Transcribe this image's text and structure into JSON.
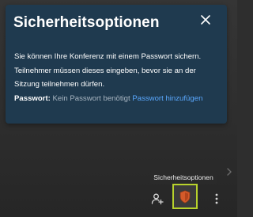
{
  "dialog": {
    "title": "Sicherheitsoptionen",
    "description": "Sie können Ihre Konferenz mit einem Passwort sichern. Teilnehmer müssen dieses eingeben, bevor sie an der Sitzung teilnehmen dürfen.",
    "password_label": "Passwort:",
    "password_status": "Kein Passwort benötigt",
    "add_password_link": "Passwort hinzufügen"
  },
  "tooltip": {
    "text": "Sicherheitsoptionen"
  },
  "colors": {
    "dialog_bg": "#1f3a4f",
    "link": "#5aa8ff",
    "highlight_border": "#b8d22c",
    "shield_fill": "#d45a2a"
  },
  "icons": {
    "close": "close-icon",
    "invite": "person-add-icon",
    "security": "shield-icon",
    "more": "more-vertical-icon",
    "chevron": "chevron-right-icon"
  }
}
